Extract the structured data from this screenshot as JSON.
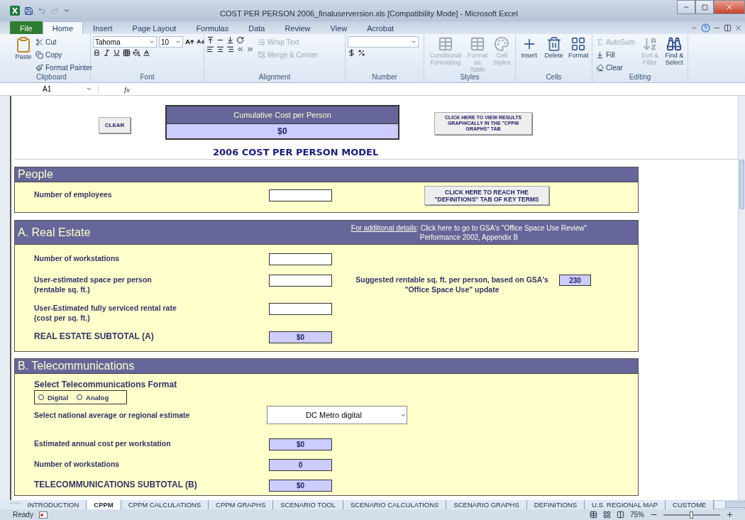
{
  "window": {
    "title": "COST PER PERSON 2006_finaluserversion.xls  [Compatibility Mode]  -  Microsoft Excel"
  },
  "ribbon_tabs": [
    {
      "label": "File",
      "kind": "file",
      "selected": false
    },
    {
      "label": "Home",
      "kind": "tab",
      "selected": true
    },
    {
      "label": "Insert",
      "kind": "tab",
      "selected": false
    },
    {
      "label": "Page Layout",
      "kind": "tab",
      "selected": false
    },
    {
      "label": "Formulas",
      "kind": "tab",
      "selected": false
    },
    {
      "label": "Data",
      "kind": "tab",
      "selected": false
    },
    {
      "label": "Review",
      "kind": "tab",
      "selected": false
    },
    {
      "label": "View",
      "kind": "tab",
      "selected": false
    },
    {
      "label": "Acrobat",
      "kind": "tab",
      "selected": false
    }
  ],
  "ribbon": {
    "groups": [
      {
        "kind": "clipboard",
        "label": "Clipboard",
        "items": [
          {
            "label": "Paste"
          },
          {
            "label": "Cut"
          },
          {
            "label": "Copy"
          },
          {
            "label": "Format Painter"
          }
        ]
      },
      {
        "kind": "font",
        "label": "Font",
        "font_name": "Tahoma",
        "font_size": "10"
      },
      {
        "kind": "alignment",
        "label": "Alignment",
        "items": [
          {
            "label": "Wrap Text",
            "disabled": true
          },
          {
            "label": "Merge & Center",
            "disabled": true
          }
        ]
      },
      {
        "kind": "number",
        "label": "Number"
      },
      {
        "kind": "large",
        "label": "Styles",
        "items": [
          {
            "label": "Conditional Formatting",
            "disabled": true
          },
          {
            "label": "Format as Table",
            "disabled": true
          },
          {
            "label": "Cell Styles",
            "disabled": true
          }
        ]
      },
      {
        "kind": "large",
        "label": "Cells",
        "items": [
          {
            "label": "Insert",
            "disabled": false
          },
          {
            "label": "Delete",
            "disabled": false
          },
          {
            "label": "Format",
            "disabled": false
          }
        ]
      },
      {
        "kind": "editing",
        "label": "Editing",
        "items": [
          {
            "label": "AutoSum",
            "disabled": true
          },
          {
            "label": "Fill",
            "disabled": false
          },
          {
            "label": "Clear",
            "disabled": false
          }
        ],
        "large": [
          {
            "label": "Sort & Filter",
            "disabled": true
          },
          {
            "label": "Find & Select",
            "disabled": false
          }
        ]
      }
    ]
  },
  "formula_bar": {
    "name_box": "A1",
    "function_label": "fx"
  },
  "sheet": {
    "clear_button": "CLEAR",
    "summary": {
      "label": "Cumulative Cost per Person",
      "value": "$0"
    },
    "graphs_button": "CLICK HERE TO VIEW RESULTS GRAPHICALLY IN THE \"CPPM GRAPHS\" TAB",
    "title": "2006 COST PER PERSON MODEL"
  },
  "sections": [
    {
      "title": "People",
      "rows": [
        {
          "kind": "input",
          "label": "Number of employees",
          "button": "CLICK HERE  TO REACH THE \"DEFINITIONS\"  TAB OF KEY TERMS"
        }
      ]
    },
    {
      "title": "A.  Real Estate",
      "link": "For additional details",
      "link_rest": ": Click here to go to GSA's \"Office Space Use Review\" Performance 2002, Appendix B",
      "rows": [
        {
          "kind": "input",
          "label": "Number of workstations"
        },
        {
          "kind": "input",
          "label": "User-estimated space per person\n(rentable sq. ft.)",
          "note": "Suggested rentable sq. ft. per person, based on GSA's \"Office Space Use\" update",
          "note_value": "230"
        },
        {
          "kind": "input",
          "label": "User-Estimated fully serviced rental rate\n (cost per sq. ft.)"
        },
        {
          "kind": "subtotal",
          "label": "REAL ESTATE SUBTOTAL (A)",
          "value": "$0"
        }
      ]
    },
    {
      "title": "B.  Telecommunications",
      "rows": [
        {
          "kind": "radio",
          "label": "Select Telecommunications Format",
          "options": [
            {
              "label": "Digital",
              "selected": false
            },
            {
              "label": "Analog",
              "selected": false
            }
          ]
        },
        {
          "kind": "dropdown",
          "label": "Select national average or regional estimate",
          "value": "DC Metro digital"
        },
        {
          "kind": "output",
          "label": "Estimated annual cost per workstation",
          "value": "$0"
        },
        {
          "kind": "output",
          "label": "Number of workstations",
          "value": "0"
        },
        {
          "kind": "subtotal",
          "label": "TELECOMMUNICATIONS SUBTOTAL (B)",
          "value": "$0"
        }
      ]
    }
  ],
  "sheet_tabs": [
    {
      "label": "INTRODUCTION",
      "selected": false
    },
    {
      "label": "CPPM",
      "selected": true
    },
    {
      "label": "CPPM CALCULATIONS",
      "selected": false
    },
    {
      "label": "CPPM GRAPHS",
      "selected": false
    },
    {
      "label": "SCENARIO TOOL",
      "selected": false
    },
    {
      "label": "SCENARIO CALCULATIONS",
      "selected": false
    },
    {
      "label": "SCENARIO GRAPHS",
      "selected": false
    },
    {
      "label": "DEFINITIONS",
      "selected": false
    },
    {
      "label": "U.S. REGIONAL MAP",
      "selected": false
    },
    {
      "label": "CUSTOME",
      "selected": false
    }
  ],
  "status_bar": {
    "status": "Ready",
    "zoom": "75%",
    "zoom_slider": {
      "level": 0.5
    }
  }
}
